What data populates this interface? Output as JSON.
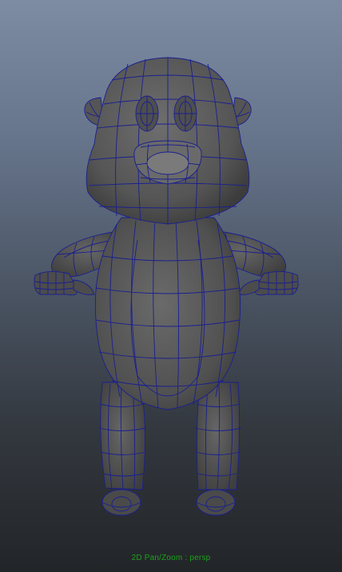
{
  "viewport": {
    "camera_readout": "2D Pan/Zoom : persp",
    "model": {
      "name": "cartoon-creature",
      "display": "smooth-shaded-with-wireframe",
      "wire_color": "#1a1f8f",
      "surface_color": "#5a5a5a"
    },
    "background": {
      "top_color": "#7d8ba3",
      "bottom_color": "#222528"
    }
  }
}
